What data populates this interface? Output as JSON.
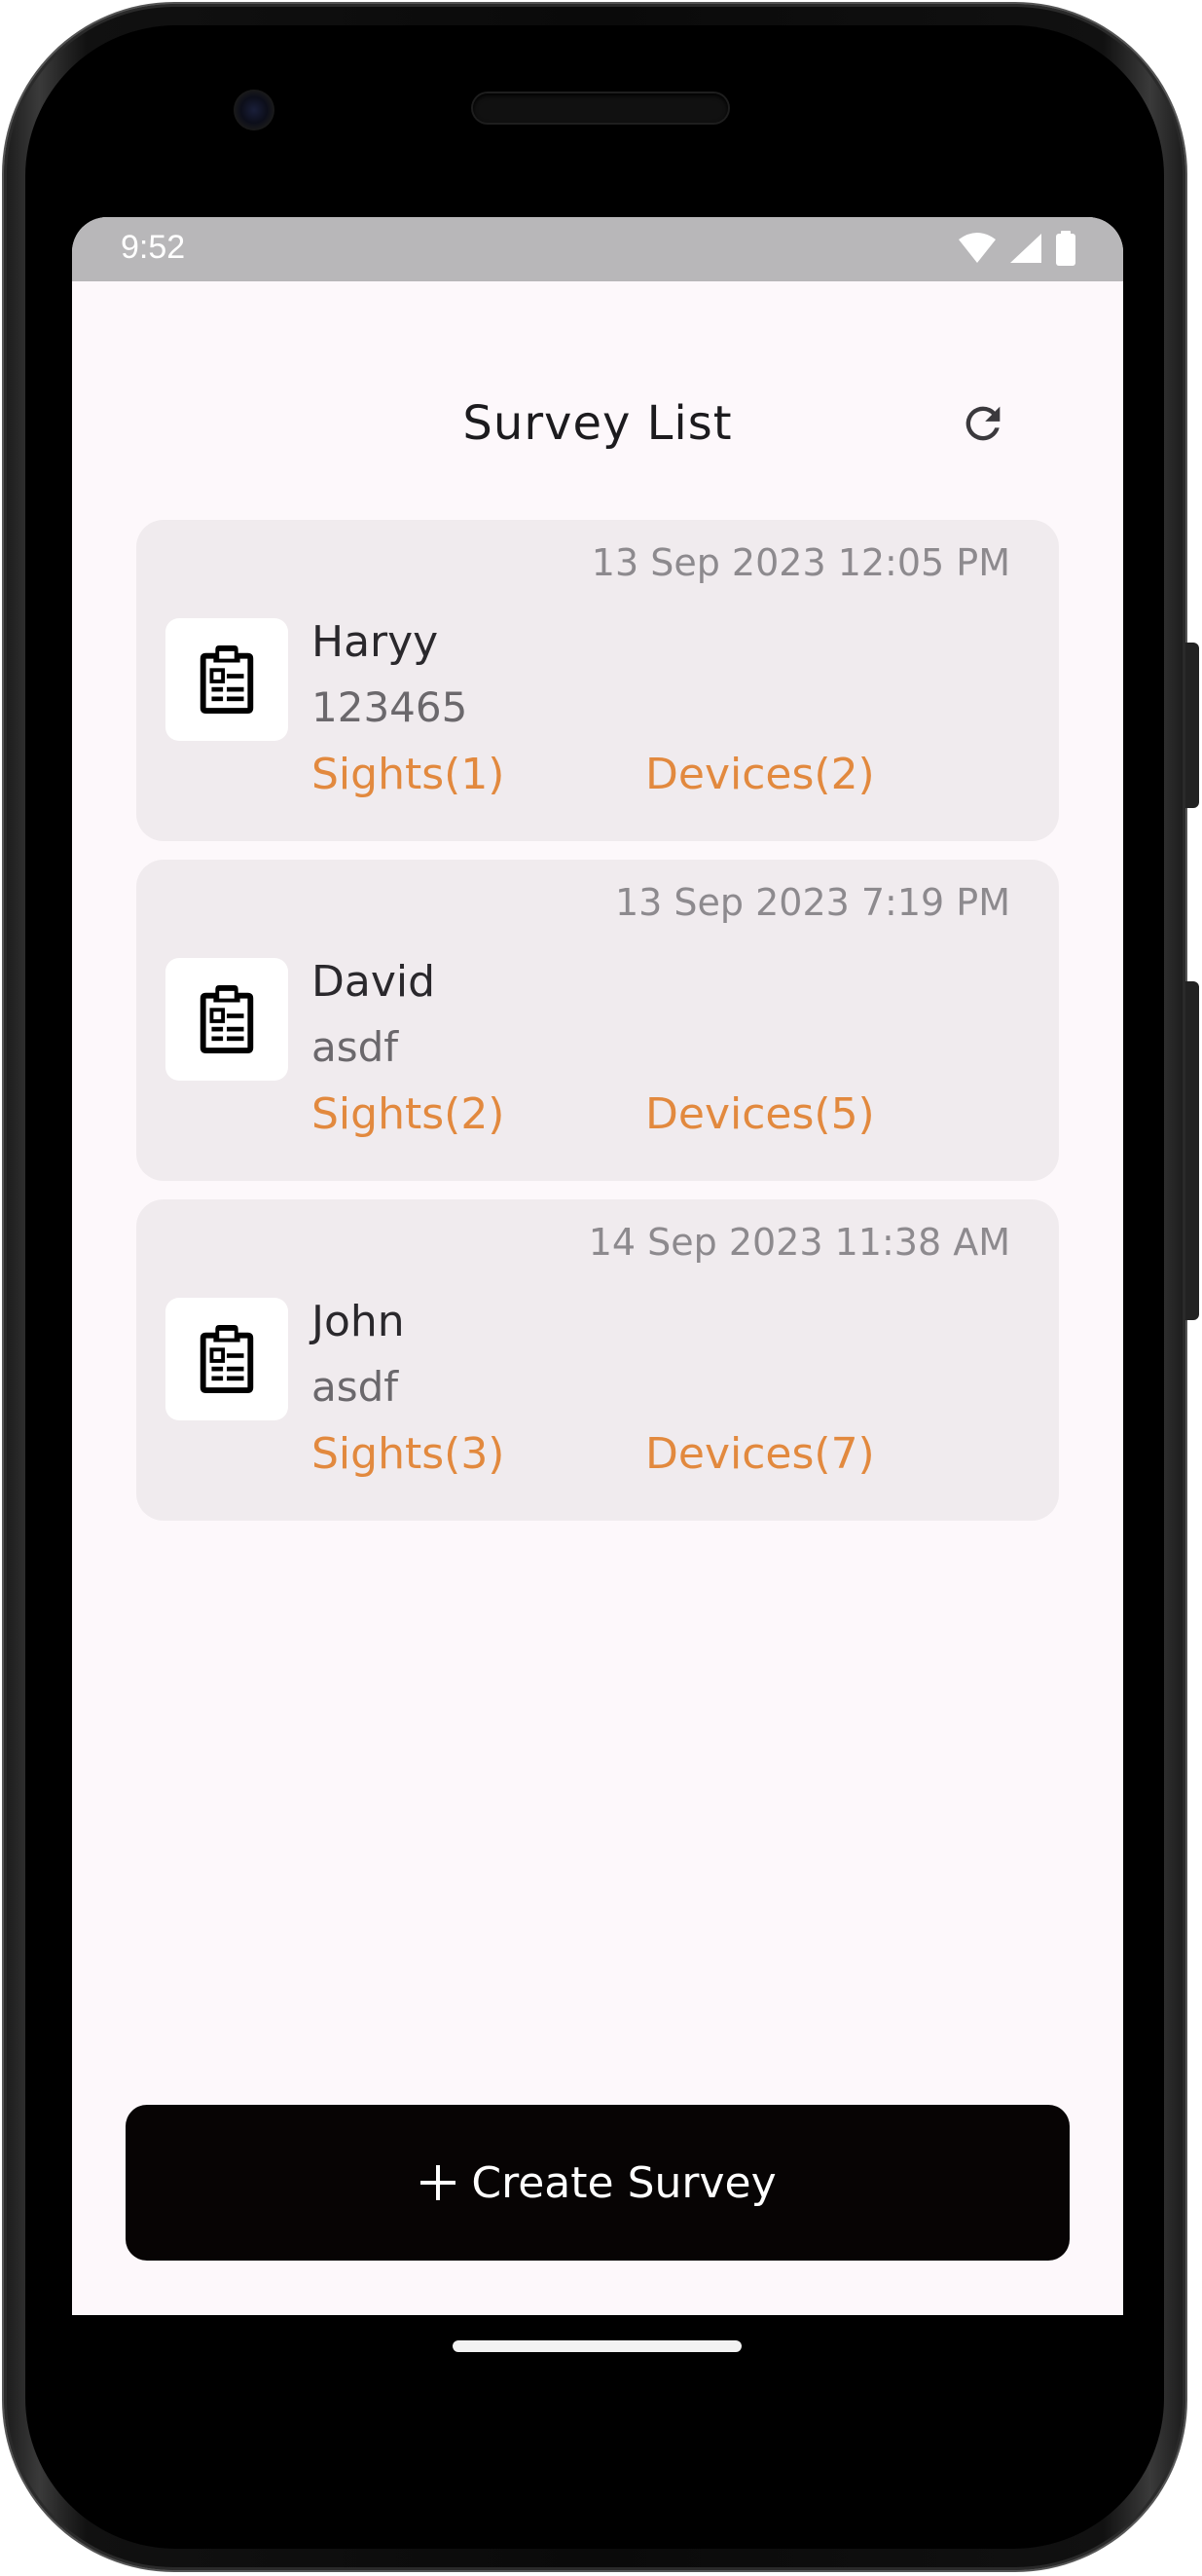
{
  "status_bar": {
    "time": "9:52",
    "icons": [
      "wifi-icon",
      "cellular-signal-icon",
      "battery-icon"
    ]
  },
  "header": {
    "title": "Survey List",
    "refresh_icon": "refresh-icon"
  },
  "surveys": [
    {
      "date": "13 Sep 2023 12:05 PM",
      "name": "Haryy",
      "subtitle": "123465",
      "sights": "Sights(1)",
      "devices": "Devices(2)"
    },
    {
      "date": "13 Sep 2023 7:19 PM",
      "name": "David",
      "subtitle": "asdf",
      "sights": "Sights(2)",
      "devices": "Devices(5)"
    },
    {
      "date": "14 Sep 2023 11:38 AM",
      "name": "John",
      "subtitle": "asdf",
      "sights": "Sights(3)",
      "devices": "Devices(7)"
    }
  ],
  "create_button": {
    "label": "Create Survey",
    "icon": "plus-icon"
  },
  "colors": {
    "accent": "#e2893e",
    "card_background": "#f0ebee",
    "screen_background": "#fdf8fb",
    "button_background": "#070404"
  }
}
